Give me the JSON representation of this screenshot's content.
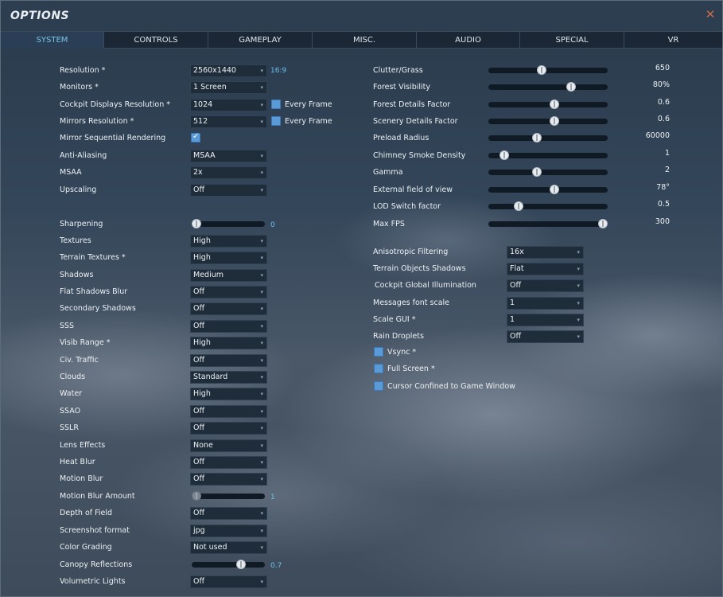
{
  "window": {
    "title": "OPTIONS",
    "close_glyph": "✕"
  },
  "tabs": [
    {
      "label": "SYSTEM",
      "active": true
    },
    {
      "label": "CONTROLS",
      "active": false
    },
    {
      "label": "GAMEPLAY",
      "active": false
    },
    {
      "label": "MISC.",
      "active": false
    },
    {
      "label": "AUDIO",
      "active": false
    },
    {
      "label": "SPECIAL",
      "active": false
    },
    {
      "label": "VR",
      "active": false
    }
  ],
  "left": {
    "resolution": {
      "label": "Resolution *",
      "value": "2560x1440",
      "aspect": "16:9"
    },
    "monitors": {
      "label": "Monitors *",
      "value": "1 Screen"
    },
    "cockpit_displays": {
      "label": "Cockpit Displays Resolution *",
      "value": "1024",
      "check_label": "Every Frame"
    },
    "mirrors": {
      "label": "Mirrors Resolution *",
      "value": "512",
      "check_label": "Every Frame"
    },
    "mirror_seq": {
      "label": "Mirror Sequential Rendering",
      "checked": true
    },
    "anti_aliasing": {
      "label": "Anti-Aliasing",
      "value": "MSAA"
    },
    "msaa": {
      "label": "MSAA",
      "value": "2x"
    },
    "upscaling": {
      "label": "Upscaling",
      "value": "Off"
    },
    "sharpening": {
      "label": "Sharpening",
      "value": "0",
      "level": 0
    },
    "textures": {
      "label": "Textures",
      "value": "High"
    },
    "terrain_textures": {
      "label": "Terrain Textures *",
      "value": "High"
    },
    "shadows": {
      "label": "Shadows",
      "value": "Medium"
    },
    "flat_shadows_blur": {
      "label": "Flat Shadows Blur",
      "value": "Off"
    },
    "secondary_shadows": {
      "label": "Secondary Shadows",
      "value": "Off"
    },
    "sss": {
      "label": "SSS",
      "value": "Off"
    },
    "visib_range": {
      "label": "Visib Range *",
      "value": "High"
    },
    "civ_traffic": {
      "label": "Civ. Traffic",
      "value": "Off"
    },
    "clouds": {
      "label": "Clouds",
      "value": "Standard"
    },
    "water": {
      "label": "Water",
      "value": "High"
    },
    "ssao": {
      "label": "SSAO",
      "value": "Off"
    },
    "sslr": {
      "label": "SSLR",
      "value": "Off"
    },
    "lens_effects": {
      "label": "Lens Effects",
      "value": "None"
    },
    "heat_blur": {
      "label": "Heat Blur",
      "value": "Off"
    },
    "motion_blur": {
      "label": "Motion Blur",
      "value": "Off"
    },
    "motion_blur_amount": {
      "label": "Motion Blur Amount",
      "value": "1",
      "level": 0
    },
    "depth_of_field": {
      "label": "Depth of Field",
      "value": "Off"
    },
    "screenshot_format": {
      "label": "Screenshot format",
      "value": "jpg"
    },
    "color_grading": {
      "label": "Color Grading",
      "value": "Not used"
    },
    "canopy_reflections": {
      "label": "Canopy Reflections",
      "value": "0.7",
      "level": 0.7
    },
    "volumetric_lights": {
      "label": "Volumetric Lights",
      "value": "Off"
    }
  },
  "right": {
    "clutter": {
      "label": "Clutter/Grass",
      "value": "650",
      "level": 0.44
    },
    "forest_visibility": {
      "label": "Forest Visibility",
      "value": "80%",
      "level": 0.71
    },
    "forest_details": {
      "label": "Forest Details Factor",
      "value": "0.6",
      "level": 0.56
    },
    "scenery_details": {
      "label": "Scenery Details Factor",
      "value": "0.6",
      "level": 0.56
    },
    "preload_radius": {
      "label": "Preload Radius",
      "value": "60000",
      "level": 0.4
    },
    "chimney_smoke": {
      "label": "Chimney Smoke Density",
      "value": "1",
      "level": 0.1
    },
    "gamma": {
      "label": "Gamma",
      "value": "2",
      "level": 0.4
    },
    "external_fov": {
      "label": "External field of view",
      "value": "78°",
      "level": 0.56
    },
    "lod_switch": {
      "label": "LOD Switch factor",
      "value": "0.5",
      "level": 0.23
    },
    "max_fps": {
      "label": "Max FPS",
      "value": "300",
      "level": 1.0
    },
    "anisotropic": {
      "label": "Anisotropic Filtering",
      "value": "16x"
    },
    "terrain_objects_shadows": {
      "label": "Terrain Objects Shadows",
      "value": "Flat"
    },
    "cockpit_gi": {
      "label": "Cockpit Global Illumination",
      "value": "Off"
    },
    "messages_font_scale": {
      "label": "Messages font scale",
      "value": "1"
    },
    "scale_gui": {
      "label": "Scale GUI *",
      "value": "1"
    },
    "rain_droplets": {
      "label": "Rain Droplets",
      "value": "Off"
    },
    "vsync": {
      "label": "Vsync *",
      "checked": false
    },
    "full_screen": {
      "label": "Full Screen *",
      "checked": false
    },
    "cursor_confined": {
      "label": "Cursor Confined to Game Window",
      "checked": false
    }
  },
  "icons": {
    "dropdown_arrow": "▾",
    "close": "close-icon",
    "check": "checkmark-icon"
  },
  "colors": {
    "accent": "#7cc4ea",
    "checkbox": "#5a9ad6",
    "close": "#c96a4a",
    "tab_bar": "#1b2734"
  }
}
